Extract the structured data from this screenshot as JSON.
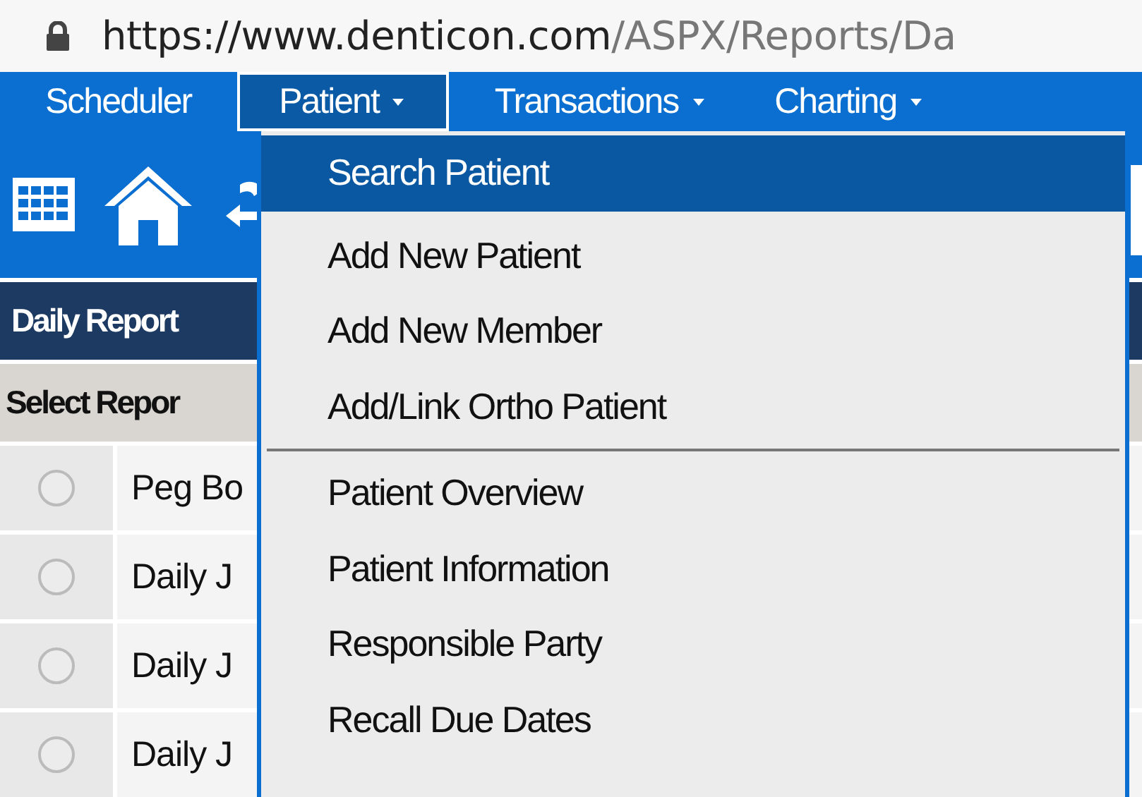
{
  "address_bar": {
    "url_host": "https://www.denticon.com",
    "url_path": "/ASPX/Reports/Da"
  },
  "nav": [
    {
      "label": "Scheduler",
      "dropdown": false,
      "selected": false
    },
    {
      "label": "Patient",
      "dropdown": true,
      "selected": true
    },
    {
      "label": "Transactions",
      "dropdown": true,
      "selected": false
    },
    {
      "label": "Charting",
      "dropdown": true,
      "selected": false
    }
  ],
  "panel": {
    "title": "Daily Report",
    "column_header": "Select Repor",
    "rows": [
      {
        "label": "Peg Bo",
        "selected": false
      },
      {
        "label": "Daily J",
        "selected": false
      },
      {
        "label": "Daily J",
        "selected": false
      },
      {
        "label": "Daily J",
        "selected": false
      }
    ]
  },
  "menu": {
    "items": [
      {
        "kind": "item",
        "label": "Search Patient",
        "selected": true
      },
      {
        "kind": "item",
        "label": "Add New Patient",
        "selected": false
      },
      {
        "kind": "item",
        "label": "Add New Member",
        "selected": false
      },
      {
        "kind": "item",
        "label": "Add/Link Ortho Patient",
        "selected": false
      },
      {
        "kind": "separator"
      },
      {
        "kind": "item",
        "label": "Patient Overview",
        "selected": false
      },
      {
        "kind": "item",
        "label": "Patient Information",
        "selected": false
      },
      {
        "kind": "item",
        "label": "Responsible Party",
        "selected": false
      },
      {
        "kind": "item",
        "label": "Recall Due Dates",
        "selected": false
      }
    ]
  }
}
